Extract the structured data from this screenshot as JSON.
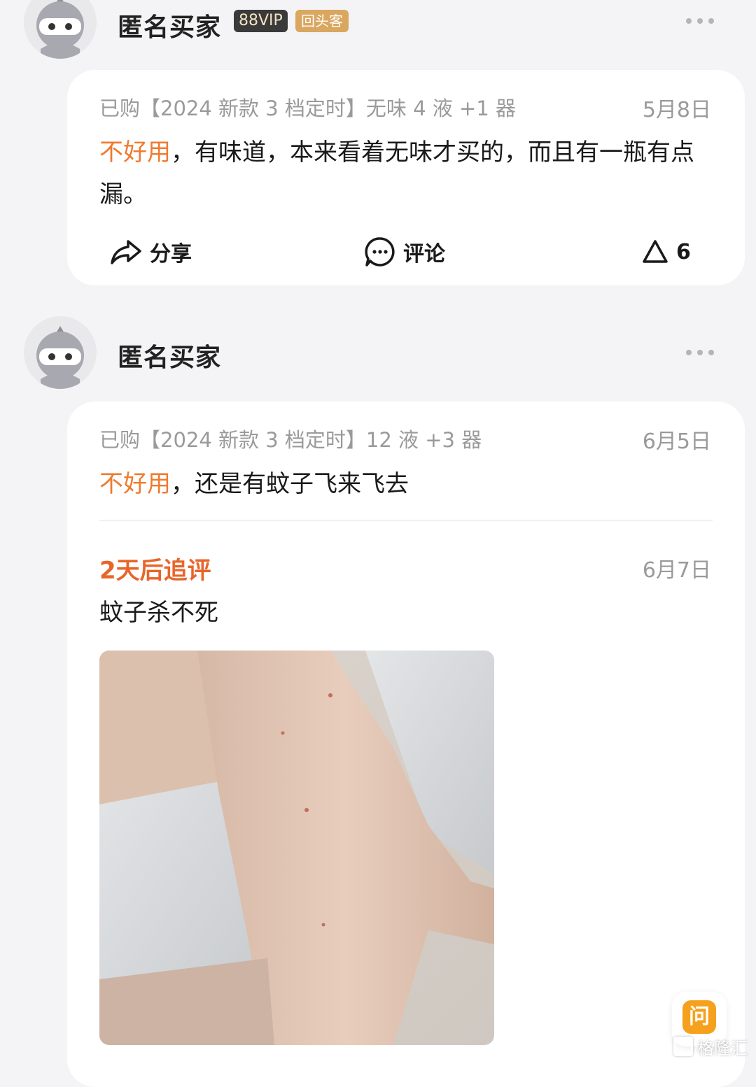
{
  "reviews": [
    {
      "username": "匿名买家",
      "badges": {
        "vip": "88VIP",
        "returning": "回头客"
      },
      "product": "已购【2024 新款 3 档定时】无味 4 液 +1 器",
      "date": "5月8日",
      "rating_word": "不好用",
      "text": "，有味道，本来看着无味才买的，而且有一瓶有点漏。",
      "actions": {
        "share": "分享",
        "comment": "评论",
        "likes": "6"
      }
    },
    {
      "username": "匿名买家",
      "product": "已购【2024 新款 3 档定时】12 液 +3 器",
      "date": "6月5日",
      "rating_word": "不好用",
      "text": "，还是有蚊子飞来飞去",
      "followup": {
        "title": "2天后追评",
        "date": "6月7日",
        "text": "蚊子杀不死"
      }
    }
  ],
  "floating": {
    "ask_label": "问"
  },
  "watermark": "格隆汇",
  "icons": [
    "avatar",
    "more-icon",
    "share-icon",
    "comment-icon",
    "like-icon"
  ],
  "colors": {
    "accent": "#f07a2e",
    "followup": "#e8652a",
    "muted": "#9a9a9a"
  }
}
